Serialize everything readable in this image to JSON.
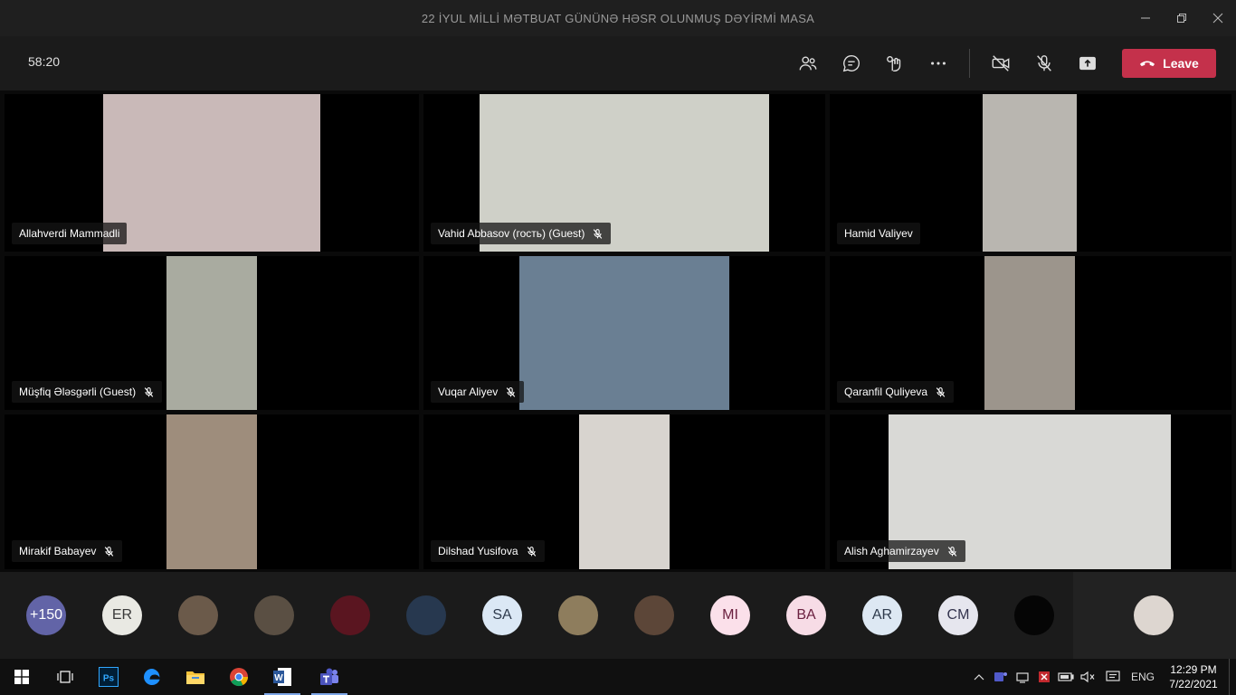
{
  "window": {
    "title": "22 İYUL MİLLİ MƏTBUAT GÜNÜNƏ HƏSR OLUNMUŞ DƏYİRMİ MASA",
    "controls": [
      "minimize-icon",
      "restore-icon",
      "close-icon"
    ]
  },
  "toolbar": {
    "timer": "58:20",
    "tools": [
      "participants-icon",
      "chat-icon",
      "reactions-icon",
      "more-icon",
      "camera-off-icon",
      "mic-off-icon",
      "share-icon"
    ],
    "leave_label": "Leave",
    "leave_color": "#c4314b"
  },
  "tiles": [
    {
      "name": "Allahverdi Mammadli",
      "muted": false,
      "bg": "#c9b9b8"
    },
    {
      "name": "Vahid Abbasov (гость) (Guest)",
      "muted": true,
      "bg": "#cfd0c8"
    },
    {
      "name": "Hamid Valiyev",
      "muted": false,
      "bg": "#b9b6b0"
    },
    {
      "name": "Müşfiq Ələsgərli (Guest)",
      "muted": true,
      "bg": "#a9aba0"
    },
    {
      "name": "Vuqar Aliyev",
      "muted": true,
      "bg": "#6a7f93"
    },
    {
      "name": "Qaranfil Quliyeva",
      "muted": true,
      "bg": "#9c958c"
    },
    {
      "name": "Mirakif Babayev",
      "muted": true,
      "bg": "#9e8d7c"
    },
    {
      "name": "Dilshad Yusifova",
      "muted": true,
      "bg": "#d8d4cf"
    },
    {
      "name": "Alish Aghamirzayev",
      "muted": true,
      "bg": "#d9d9d6"
    }
  ],
  "strip": {
    "avatars": [
      {
        "label": "+150",
        "bg": "#6264a7",
        "fg": "#ffffff"
      },
      {
        "label": "ER",
        "bg": "#e9e9e3",
        "fg": "#3a3a3a"
      },
      {
        "label": "",
        "bg": "#6b5a4a",
        "fg": "#ffffff"
      },
      {
        "label": "",
        "bg": "#5a4f43",
        "fg": "#ffffff"
      },
      {
        "label": "",
        "bg": "#5a1520",
        "fg": "#ffffff"
      },
      {
        "label": "",
        "bg": "#27384f",
        "fg": "#ffffff"
      },
      {
        "label": "SA",
        "bg": "#dbe8f5",
        "fg": "#2f3b4d"
      },
      {
        "label": "",
        "bg": "#8e7d5d",
        "fg": "#ffffff"
      },
      {
        "label": "",
        "bg": "#5c4638",
        "fg": "#ffffff"
      },
      {
        "label": "MI",
        "bg": "#fbe0ea",
        "fg": "#6b2140"
      },
      {
        "label": "BA",
        "bg": "#f7dce6",
        "fg": "#6b2140"
      },
      {
        "label": "AR",
        "bg": "#dde8f3",
        "fg": "#2f3b4d"
      },
      {
        "label": "CM",
        "bg": "#e6e6ee",
        "fg": "#33334d"
      },
      {
        "label": "",
        "bg": "#050505",
        "fg": "#ffffff"
      }
    ],
    "self_bg": "#ddd6d0"
  },
  "taskbar": {
    "apps": [
      "windows-start-icon",
      "task-view-icon",
      "photoshop-icon",
      "edge-icon",
      "file-explorer-icon",
      "chrome-icon",
      "word-icon",
      "teams-icon"
    ],
    "ps_label": "Ps",
    "word_label": "W",
    "language": "ENG",
    "time": "12:29 PM",
    "date": "7/22/2021"
  }
}
